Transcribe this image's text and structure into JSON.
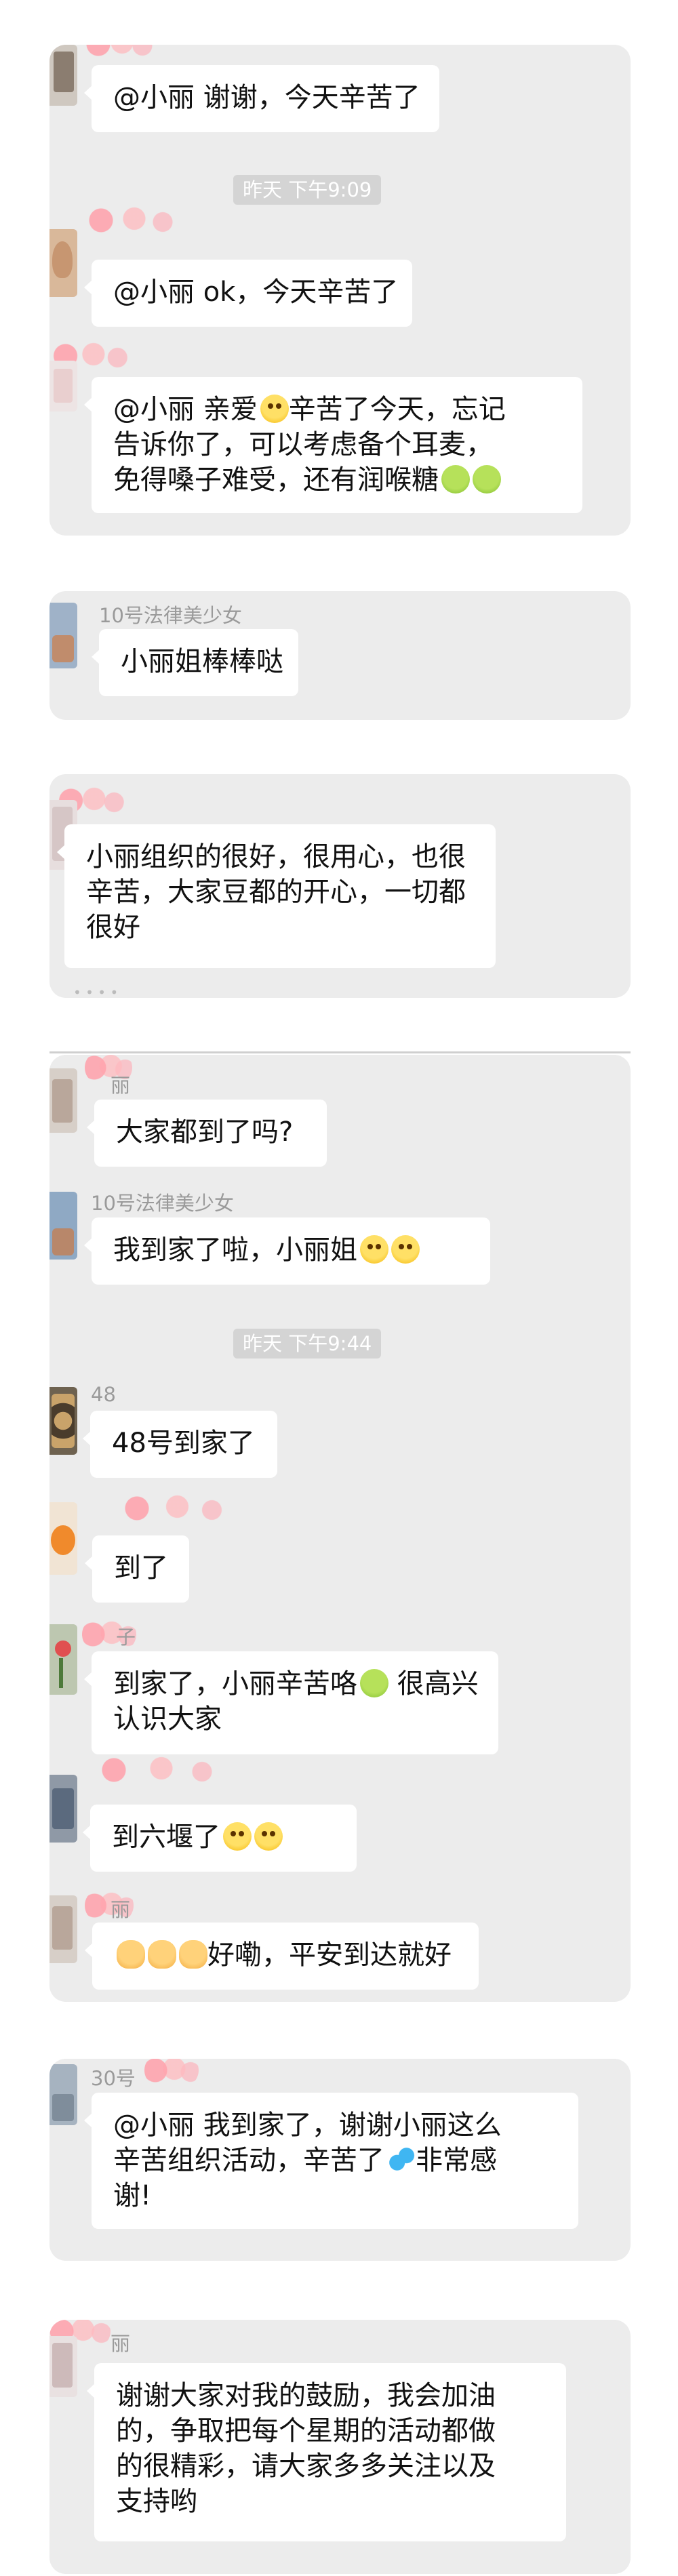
{
  "colors": {
    "card_bg": "#ececec",
    "bubble_bg": "#ffffff",
    "time_bg": "#d4d4d4",
    "name_text": "#9a9a9a"
  },
  "cards": [
    {
      "messages": [
        {
          "sender": "",
          "text_lines": [
            "@小丽 谢谢，今天辛苦了"
          ]
        },
        {
          "time": "昨天 下午9:09"
        },
        {
          "sender": "",
          "text_lines": [
            "@小丽 ok，今天辛苦了"
          ]
        },
        {
          "sender": "",
          "text_lines": [
            "@小丽 亲爱",
            "辛苦了今天，忘记",
            "告诉你了，可以考虑备个耳麦，",
            "免得嗓子难受，还有润喉糖"
          ],
          "emoji": [
            "face-icon",
            "green-face-icon",
            "green-face-icon"
          ]
        }
      ]
    },
    {
      "messages": [
        {
          "sender": "10号法律美少女",
          "text_lines": [
            "小丽姐棒棒哒"
          ]
        }
      ]
    },
    {
      "messages": [
        {
          "sender": "",
          "text_lines": [
            "小丽组织的很好，很用心，也很",
            "辛苦，大家豆都的开心，一切都",
            "很好"
          ]
        }
      ]
    },
    {
      "messages": [
        {
          "sender": "丽",
          "text_lines": [
            "大家都到了吗?"
          ]
        },
        {
          "sender": "10号法律美少女",
          "text_lines": [
            "我到家了啦，小丽姐"
          ],
          "emoji": [
            "face-icon",
            "face-icon"
          ]
        },
        {
          "time": "昨天 下午9:44"
        },
        {
          "sender": "48",
          "text_lines": [
            "48号到家了"
          ]
        },
        {
          "sender": "",
          "text_lines": [
            "到了"
          ]
        },
        {
          "sender": "子",
          "text_lines": [
            "到家了，小丽辛苦咯",
            " 很高兴",
            "认识大家"
          ],
          "emoji": [
            "green-face-icon"
          ]
        },
        {
          "sender": "",
          "text_lines": [
            "到六堰了"
          ],
          "emoji": [
            "face-icon",
            "face-icon"
          ]
        },
        {
          "sender": "丽",
          "text_lines": [
            "好嘞，平安到达就好"
          ],
          "emoji": [
            "ok-hand-icon",
            "ok-hand-icon",
            "ok-hand-icon"
          ]
        }
      ]
    },
    {
      "messages": [
        {
          "sender": "30号",
          "text_lines": [
            "@小丽 我到家了，谢谢小丽这么",
            "辛苦组织活动，辛苦了",
            "非常感",
            "谢!"
          ],
          "emoji": [
            "sweat-drops-icon"
          ]
        }
      ]
    },
    {
      "messages": [
        {
          "sender": "丽",
          "text_lines": [
            "谢谢大家对我的鼓励，我会加油",
            "的，争取把每个星期的活动都做",
            "的很精彩，请大家多多关注以及",
            "支持哟"
          ]
        }
      ]
    }
  ]
}
